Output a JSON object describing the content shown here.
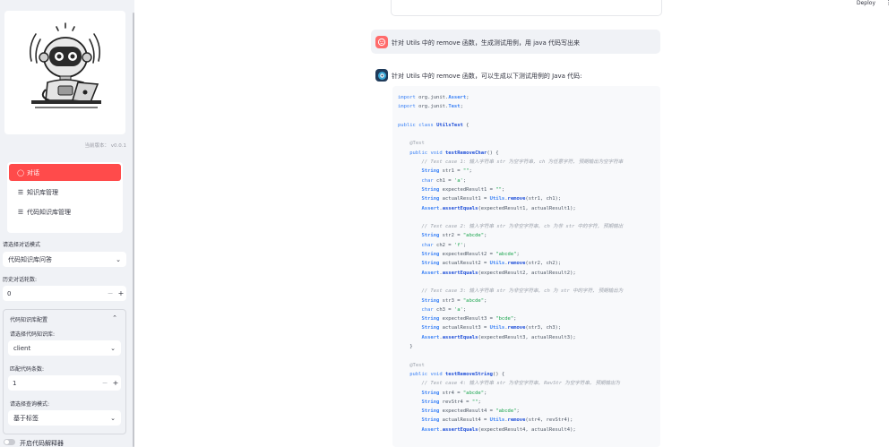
{
  "header": {
    "deploy_label": "Deploy",
    "menu_glyph": "⋮"
  },
  "sidebar": {
    "version_label": "当前版本： v0.0.1",
    "menu": [
      {
        "label": "对话",
        "icon": "chat-bubble-icon",
        "glyph": "◯",
        "active": true
      },
      {
        "label": "知识库管理",
        "icon": "list-icon",
        "glyph": "☰",
        "active": false
      },
      {
        "label": "代码知识库管理",
        "icon": "list-icon",
        "glyph": "☰",
        "active": false
      }
    ],
    "mode_label": "请选择对话模式",
    "mode_value": "代码知识库问答",
    "history_label": "历史对话轮数:",
    "history_value": "0",
    "expander_title": "代码知识库配置",
    "kb_label": "请选择代码知识库:",
    "kb_value": "client",
    "match_label": "匹配代码条数:",
    "match_value": "1",
    "query_label": "请选择查询模式:",
    "query_value": "基于标签",
    "toggle_label": "开启代码解释器",
    "chevron_down": "⌄",
    "chevron_up": "⌃",
    "minus": "−",
    "plus": "+"
  },
  "chat": {
    "user_message": "针对 Utils 中的 remove 函数，生成测试用例，用 java 代码写出来",
    "assistant_intro": "针对 Utils 中的 remove 函数，可以生成以下测试用例的 Java 代码:",
    "code_lines": [
      "import org.junit.Assert;",
      "import org.junit.Test;",
      "",
      "public class UtilsTest {",
      "",
      "    @Test",
      "    public void testRemoveChar() {",
      "        // Test case 1: 输入字符串 str 为空字符串, ch 为任意字符, 预期输出为空字符串",
      "        String str1 = \"\";",
      "        char ch1 = 'a';",
      "        String expectedResult1 = \"\";",
      "        String actualResult1 = Utils.remove(str1, ch1);",
      "        Assert.assertEquals(expectedResult1, actualResult1);",
      "",
      "        // Test case 2: 输入字符串 str 为非空字符串, ch 为非 str 中的字符, 预期输出",
      "        String str2 = \"abcde\";",
      "        char ch2 = 'f';",
      "        String expectedResult2 = \"abcde\";",
      "        String actualResult2 = Utils.remove(str2, ch2);",
      "        Assert.assertEquals(expectedResult2, actualResult2);",
      "",
      "        // Test case 3: 输入字符串 str 为非空字符串, ch 为 str 中的字符, 预期输出为",
      "        String str3 = \"abcde\";",
      "        char ch3 = 'a';",
      "        String expectedResult3 = \"bcde\";",
      "        String actualResult3 = Utils.remove(str3, ch3);",
      "        Assert.assertEquals(expectedResult3, actualResult3);",
      "    }",
      "",
      "    @Test",
      "    public void testRemoveString() {",
      "        // Test case 4: 输入字符串 str 为非空字符串, RevStr 为空字符串, 预期输出为",
      "        String str4 = \"abcde\";",
      "        String revStr4 = \"\";",
      "        String expectedResult4 = \"abcde\";",
      "        String actualResult4 = Utils.remove(str4, revStr4);",
      "        Assert.assertEquals(expectedResult4, actualResult4);"
    ]
  }
}
